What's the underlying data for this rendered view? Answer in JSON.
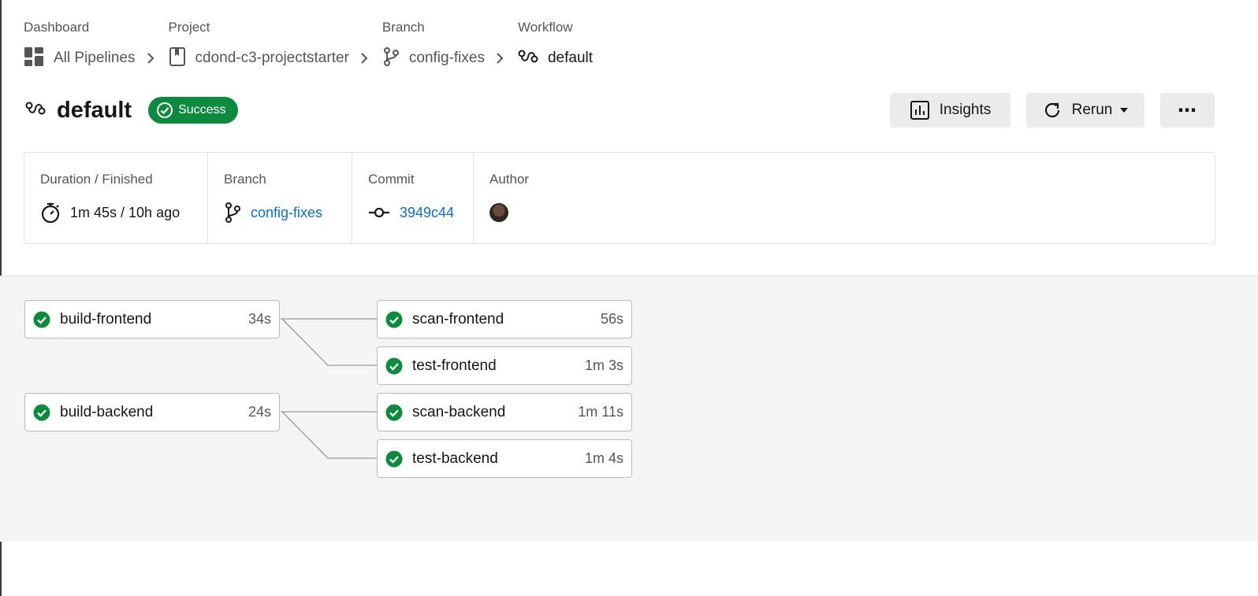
{
  "breadcrumb": [
    {
      "heading": "Dashboard",
      "label": "All Pipelines",
      "icon": "dashboard-icon"
    },
    {
      "heading": "Project",
      "label": "cdond-c3-projectstarter",
      "icon": "repo-icon"
    },
    {
      "heading": "Branch",
      "label": "config-fixes",
      "icon": "branch-icon"
    },
    {
      "heading": "Workflow",
      "label": "default",
      "icon": "workflow-icon"
    }
  ],
  "header": {
    "title": "default",
    "status": "Success",
    "status_color": "#0e8a3e",
    "buttons": {
      "insights": "Insights",
      "rerun": "Rerun",
      "more": "⋯"
    }
  },
  "meta": {
    "duration": {
      "label": "Duration / Finished",
      "value": "1m 45s / 10h ago"
    },
    "branch": {
      "label": "Branch",
      "value": "config-fixes"
    },
    "commit": {
      "label": "Commit",
      "value": "3949c44"
    },
    "author": {
      "label": "Author"
    }
  },
  "link_color": "#0a6ec9",
  "jobs": [
    {
      "name": "build-frontend",
      "duration": "34s",
      "status": "success"
    },
    {
      "name": "scan-frontend",
      "duration": "56s",
      "status": "success"
    },
    {
      "name": "test-frontend",
      "duration": "1m 3s",
      "status": "success"
    },
    {
      "name": "build-backend",
      "duration": "24s",
      "status": "success"
    },
    {
      "name": "scan-backend",
      "duration": "1m 11s",
      "status": "success"
    },
    {
      "name": "test-backend",
      "duration": "1m 4s",
      "status": "success"
    }
  ]
}
